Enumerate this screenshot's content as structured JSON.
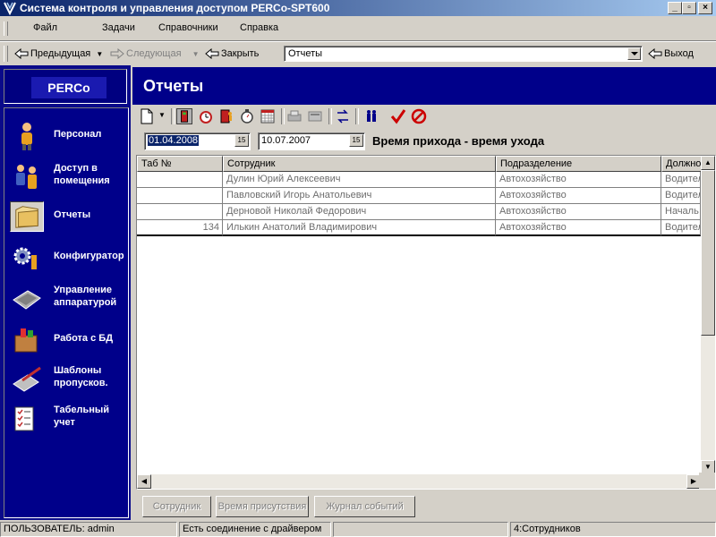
{
  "window": {
    "title": "Система контроля и управления доступом PERCo-SPT600"
  },
  "menu": {
    "items": [
      {
        "label": "Файл"
      },
      {
        "label": "Задачи"
      },
      {
        "label": "Справочники"
      },
      {
        "label": "Справка"
      }
    ]
  },
  "navbar": {
    "prev_label": "Предыдущая",
    "next_label": "Следующая",
    "close_label": "Закрыть",
    "report_value": "Отчеты",
    "exit_label": "Выход"
  },
  "sidebar": {
    "logo_text": "PERCo",
    "items": [
      {
        "label": "Персонал",
        "icon": "person-icon"
      },
      {
        "label": "Доступ в помещения",
        "icon": "people-access-icon"
      },
      {
        "label": "Отчеты",
        "icon": "folder-icon",
        "selected": true
      },
      {
        "label": "Конфигуратор",
        "icon": "gears-icon"
      },
      {
        "label": "Управление аппаратурой",
        "icon": "hardware-icon"
      },
      {
        "label": "Работа с БД",
        "icon": "database-box-icon"
      },
      {
        "label": "Шаблоны пропусков.",
        "icon": "pass-template-icon"
      },
      {
        "label": "Табельный учет",
        "icon": "timesheet-icon"
      }
    ]
  },
  "header": {
    "title": "Отчеты"
  },
  "report": {
    "date_from": "01.04.2008",
    "date_to": "10.07.2007",
    "range_title": "Время прихода - время ухода",
    "calendar_button_label": "15"
  },
  "table": {
    "columns": [
      "Таб №",
      "Сотрудник",
      "Подразделение",
      "Должно"
    ],
    "rows": [
      {
        "tab": "",
        "employee": "Дулин Юрий Алексеевич",
        "department": "Автохозяйство",
        "position": "Водител"
      },
      {
        "tab": "",
        "employee": "Павловский Игорь Анатольевич",
        "department": "Автохозяйство",
        "position": "Водител"
      },
      {
        "tab": "",
        "employee": "Дерновой Николай Федорович",
        "department": "Автохозяйство",
        "position": "Началь"
      },
      {
        "tab": "134",
        "employee": "Илькин Анатолий Владимирович",
        "department": "Автохозяйство",
        "position": "Водител"
      }
    ]
  },
  "bottom_buttons": {
    "employee": "Сотрудник",
    "presence_time": "Время присутствия",
    "event_log": "Журнал событий"
  },
  "status": {
    "user": "ПОЛЬЗОВАТЕЛЬ: admin",
    "driver": "Есть соединение с драйвером",
    "empty": "",
    "employees": "4:Сотрудников"
  },
  "colors": {
    "title_gradient_start": "#0a246a",
    "sidebar_bg": "#00008a",
    "accent_red": "#cc0000"
  }
}
